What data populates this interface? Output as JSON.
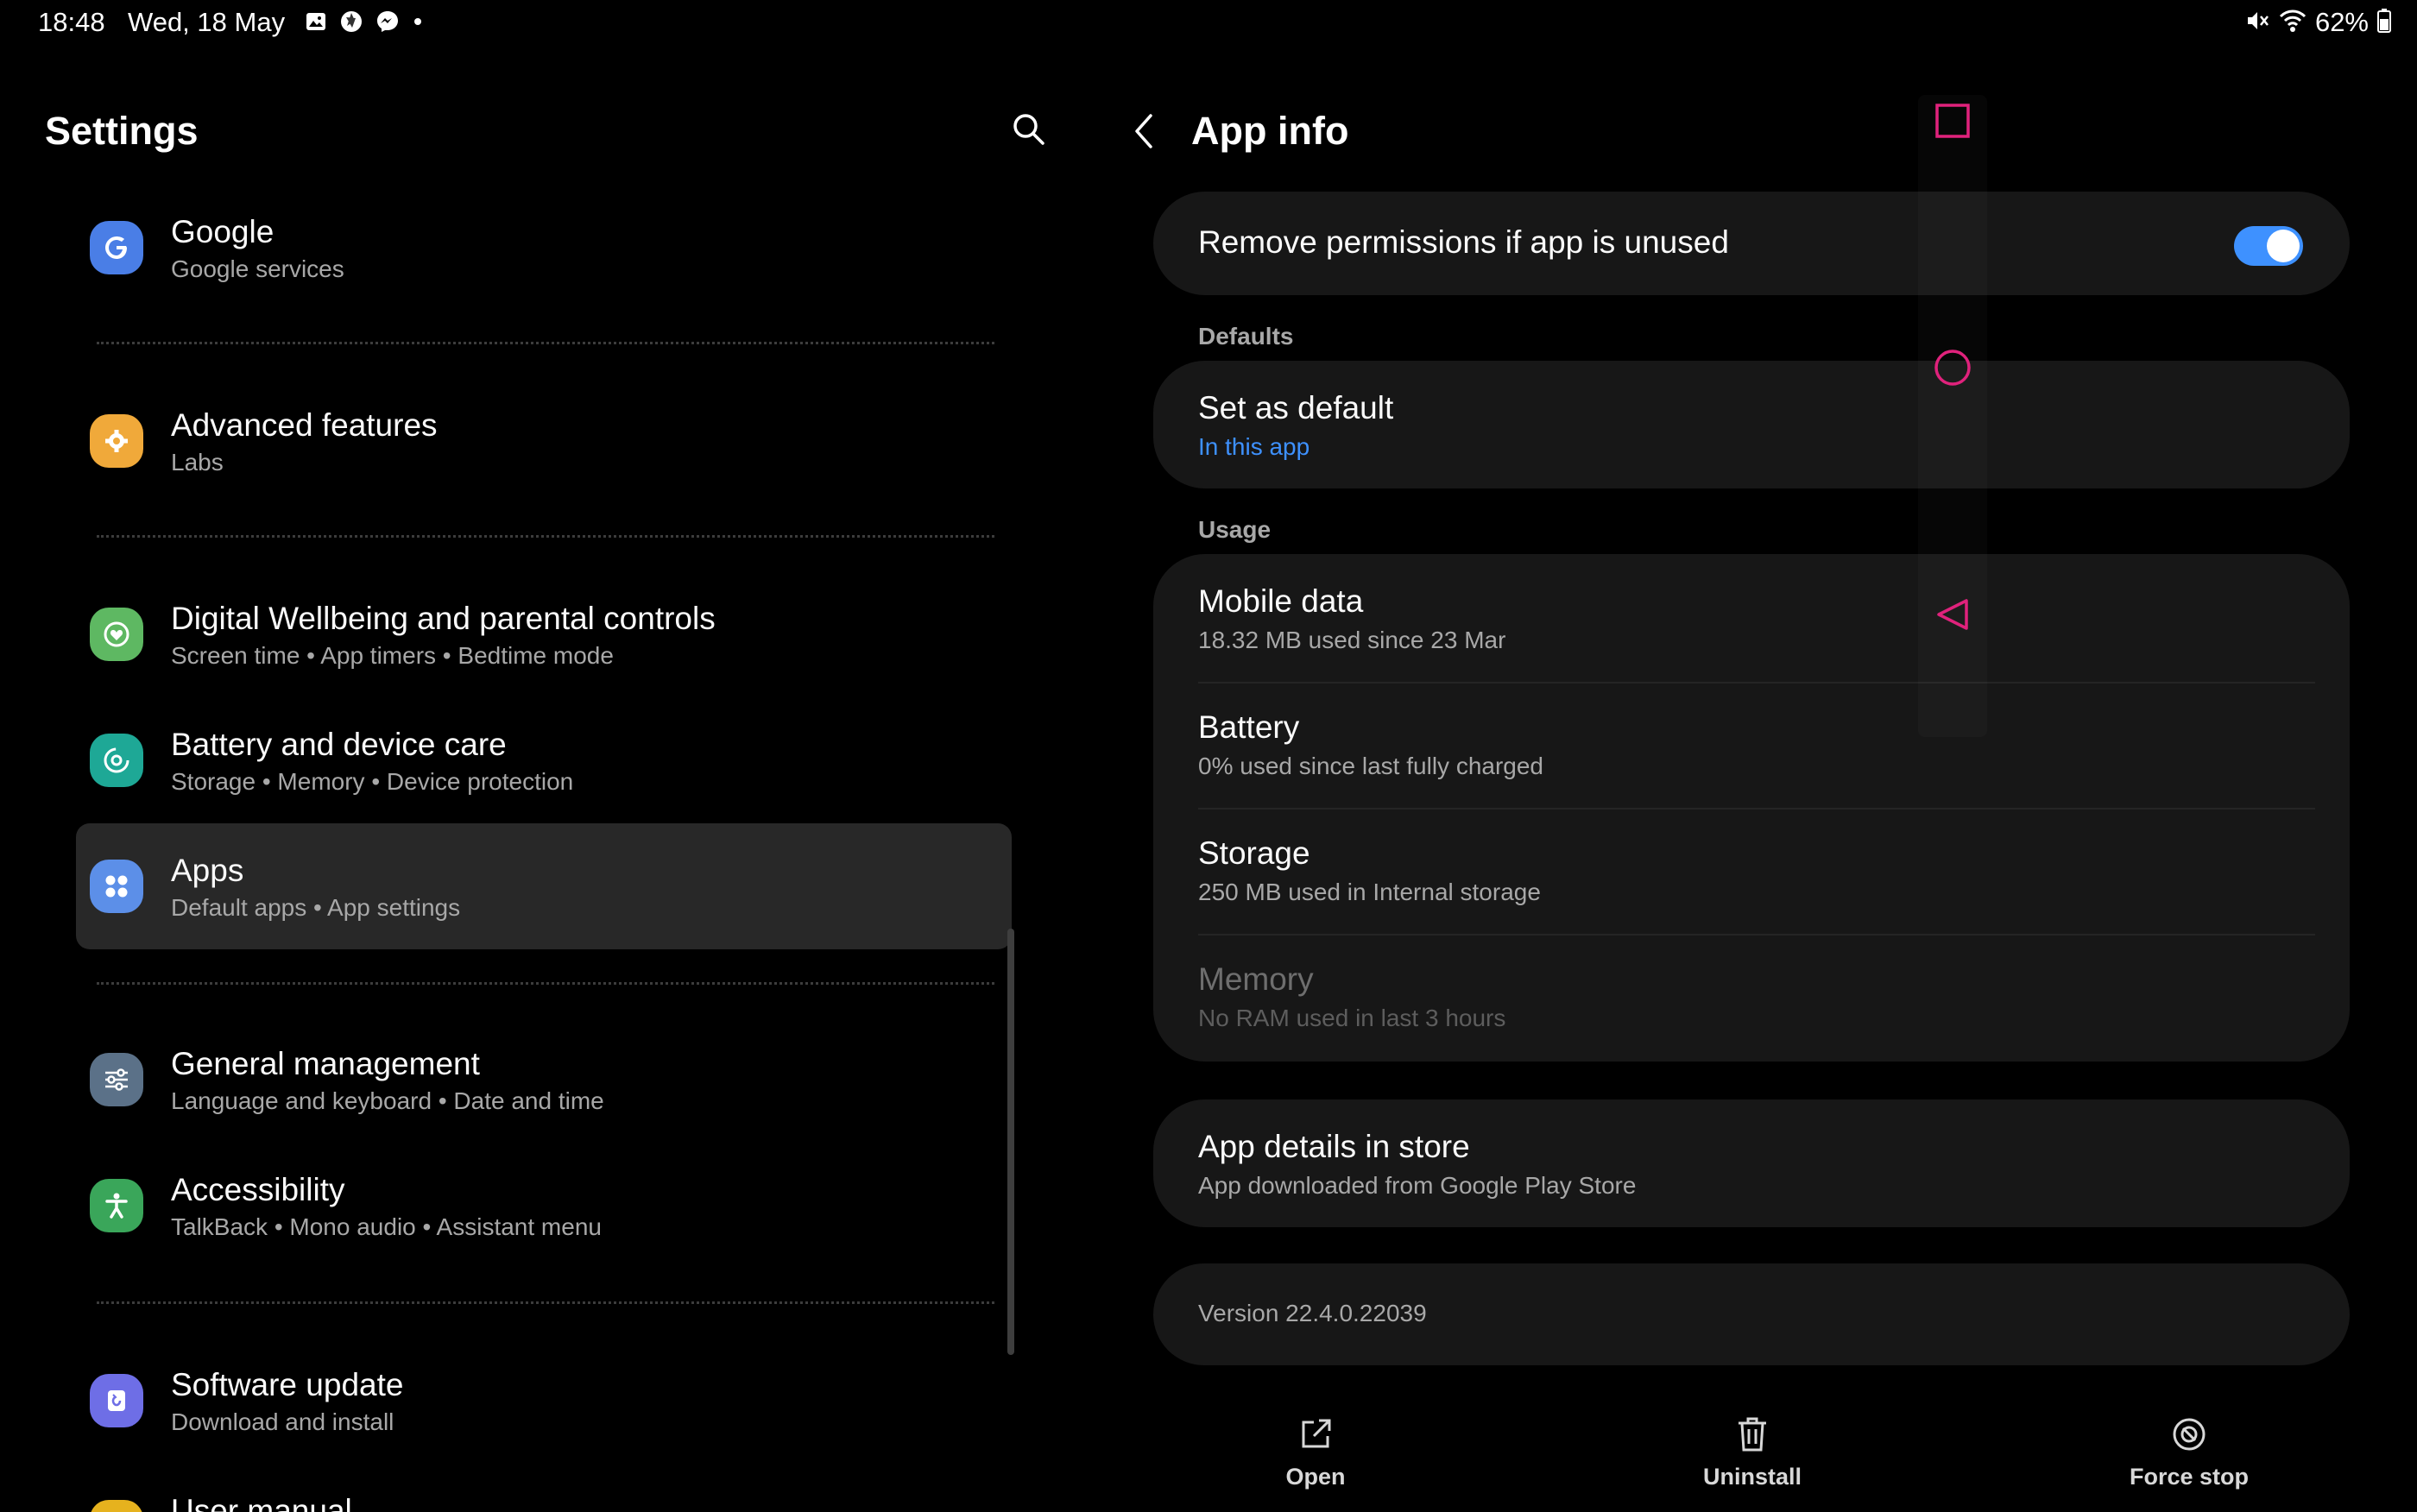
{
  "status_bar": {
    "time": "18:48",
    "date": "Wed, 18 May",
    "battery": "62%",
    "notification_icons": [
      "gallery-icon",
      "aperture-icon",
      "messenger-icon",
      "dot-icon"
    ],
    "system_icons": [
      "mute-icon",
      "wifi-icon",
      "battery-icon"
    ]
  },
  "settings": {
    "title": "Settings",
    "items": [
      {
        "title": "Google",
        "subtitle": "Google services",
        "icon": "google-icon",
        "color": "#4a7ee6"
      },
      {
        "title": "Advanced features",
        "subtitle": "Labs",
        "icon": "puzzle-icon",
        "color": "#f0a93a"
      },
      {
        "title": "Digital Wellbeing and parental controls",
        "subtitle": "Screen time  •  App timers  •  Bedtime mode",
        "icon": "wellbeing-icon",
        "color": "#5eb862"
      },
      {
        "title": "Battery and device care",
        "subtitle": "Storage  •  Memory  •  Device protection",
        "icon": "device-care-icon",
        "color": "#1ea896"
      },
      {
        "title": "Apps",
        "subtitle": "Default apps  •  App settings",
        "icon": "apps-icon",
        "color": "#5c8fe8",
        "selected": true
      },
      {
        "title": "General management",
        "subtitle": "Language and keyboard  •  Date and time",
        "icon": "sliders-icon",
        "color": "#5b7188"
      },
      {
        "title": "Accessibility",
        "subtitle": "TalkBack  •  Mono audio  •  Assistant menu",
        "icon": "accessibility-icon",
        "color": "#3aa65a"
      },
      {
        "title": "Software update",
        "subtitle": "Download and install",
        "icon": "update-icon",
        "color": "#6e6ee6"
      },
      {
        "title": "User manual",
        "subtitle": "",
        "icon": "manual-icon",
        "color": "#e6b21e"
      }
    ]
  },
  "app_info": {
    "title": "App info",
    "remove_permissions": {
      "label": "Remove permissions if app is unused",
      "enabled": true
    },
    "defaults_header": "Defaults",
    "set_as_default": {
      "title": "Set as default",
      "subtitle": "In this app"
    },
    "usage_header": "Usage",
    "usage": [
      {
        "title": "Mobile data",
        "subtitle": "18.32 MB used since 23 Mar"
      },
      {
        "title": "Battery",
        "subtitle": "0% used since last fully charged"
      },
      {
        "title": "Storage",
        "subtitle": "250 MB used in Internal storage"
      },
      {
        "title": "Memory",
        "subtitle": "No RAM used in last 3 hours",
        "disabled": true
      }
    ],
    "store": {
      "title": "App details in store",
      "subtitle": "App downloaded from Google Play Store"
    },
    "version": "Version 22.4.0.22039",
    "actions": [
      {
        "label": "Open",
        "icon": "open-external-icon"
      },
      {
        "label": "Uninstall",
        "icon": "trash-icon"
      },
      {
        "label": "Force stop",
        "icon": "force-stop-icon"
      }
    ]
  },
  "nav_buttons": [
    "recents-icon",
    "home-icon",
    "back-triangle-icon"
  ],
  "colors": {
    "accent": "#3e91ff",
    "nav_overlay": "#e0227c",
    "card": "#171717",
    "selected": "#282828"
  }
}
